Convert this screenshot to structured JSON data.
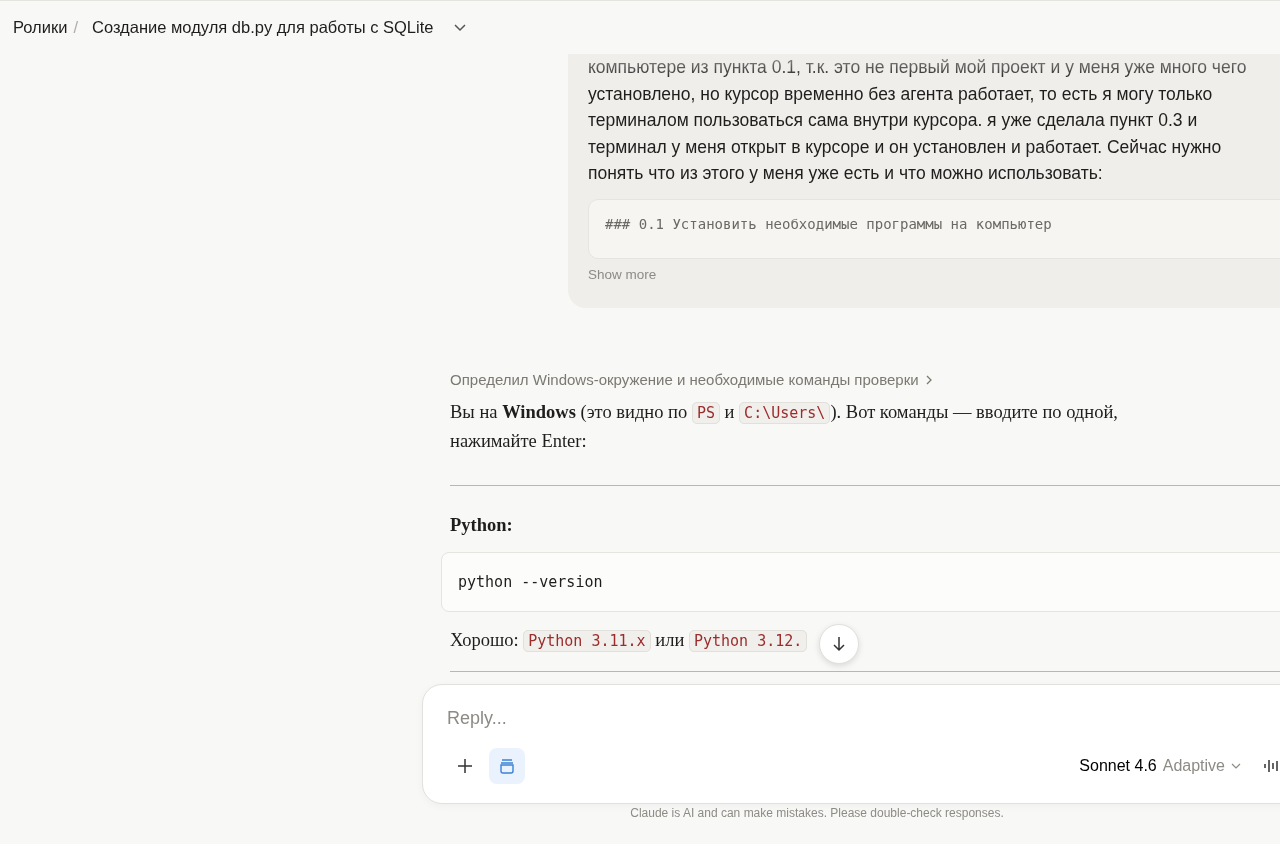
{
  "header": {
    "breadcrumb_parent": "Ролики",
    "separator": "/",
    "title": "Создание модуля db.py для работы с SQLite"
  },
  "user_message": {
    "text": "компьютере из пункта 0.1, т.к. это не первый мой проект и у меня уже много чего установлено, но курсор временно без агента работает, то есть я могу только терминалом пользоваться сама внутри курсора. я уже сделала пункт 0.3 и терминал у меня открыт в курсоре и он установлен и работает. Сейчас нужно понять что из этого у меня уже есть и что можно использовать:",
    "code_preview": "### 0.1 Установить необходимые программы на компьютер",
    "show_more": "Show more"
  },
  "assistant": {
    "thinking_summary": "Определил Windows-окружение и необходимые команды проверки",
    "blocks": [
      {
        "kind": "paragraph",
        "segments": [
          {
            "kind": "text",
            "text": "Вы на **Windows** (это видно по "
          },
          {
            "kind": "code",
            "text": "PS"
          },
          {
            "kind": "text",
            "text": " и "
          },
          {
            "kind": "code",
            "text": "C:\\Users\\"
          },
          {
            "kind": "text",
            "text": "). Вот команды — вводите по одной, нажимайте Enter:"
          }
        ]
      },
      {
        "kind": "rule"
      },
      {
        "kind": "heading",
        "text": "Python:"
      },
      {
        "kind": "codeblock",
        "text": "python --version"
      },
      {
        "kind": "paragraph",
        "segments": [
          {
            "kind": "text",
            "text": "Хорошо: "
          },
          {
            "kind": "code",
            "text": "Python 3.11.x"
          },
          {
            "kind": "text",
            "text": " или "
          },
          {
            "kind": "code",
            "text": "Python 3.12."
          }
        ]
      },
      {
        "kind": "rule"
      }
    ]
  },
  "composer": {
    "placeholder": "Reply...",
    "project_selected": true,
    "model": "Sonnet 4.6",
    "mode": "Adaptive"
  },
  "disclaimer": "Claude is AI and can make mistakes. Please double-check responses."
}
